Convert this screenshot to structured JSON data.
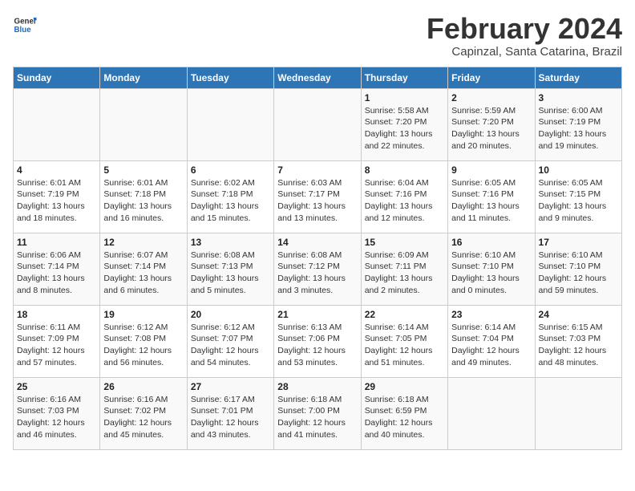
{
  "header": {
    "logo_general": "General",
    "logo_blue": "Blue",
    "month_title": "February 2024",
    "subtitle": "Capinzal, Santa Catarina, Brazil"
  },
  "days_of_week": [
    "Sunday",
    "Monday",
    "Tuesday",
    "Wednesday",
    "Thursday",
    "Friday",
    "Saturday"
  ],
  "weeks": [
    [
      {
        "day": "",
        "info": ""
      },
      {
        "day": "",
        "info": ""
      },
      {
        "day": "",
        "info": ""
      },
      {
        "day": "",
        "info": ""
      },
      {
        "day": "1",
        "info": "Sunrise: 5:58 AM\nSunset: 7:20 PM\nDaylight: 13 hours\nand 22 minutes."
      },
      {
        "day": "2",
        "info": "Sunrise: 5:59 AM\nSunset: 7:20 PM\nDaylight: 13 hours\nand 20 minutes."
      },
      {
        "day": "3",
        "info": "Sunrise: 6:00 AM\nSunset: 7:19 PM\nDaylight: 13 hours\nand 19 minutes."
      }
    ],
    [
      {
        "day": "4",
        "info": "Sunrise: 6:01 AM\nSunset: 7:19 PM\nDaylight: 13 hours\nand 18 minutes."
      },
      {
        "day": "5",
        "info": "Sunrise: 6:01 AM\nSunset: 7:18 PM\nDaylight: 13 hours\nand 16 minutes."
      },
      {
        "day": "6",
        "info": "Sunrise: 6:02 AM\nSunset: 7:18 PM\nDaylight: 13 hours\nand 15 minutes."
      },
      {
        "day": "7",
        "info": "Sunrise: 6:03 AM\nSunset: 7:17 PM\nDaylight: 13 hours\nand 13 minutes."
      },
      {
        "day": "8",
        "info": "Sunrise: 6:04 AM\nSunset: 7:16 PM\nDaylight: 13 hours\nand 12 minutes."
      },
      {
        "day": "9",
        "info": "Sunrise: 6:05 AM\nSunset: 7:16 PM\nDaylight: 13 hours\nand 11 minutes."
      },
      {
        "day": "10",
        "info": "Sunrise: 6:05 AM\nSunset: 7:15 PM\nDaylight: 13 hours\nand 9 minutes."
      }
    ],
    [
      {
        "day": "11",
        "info": "Sunrise: 6:06 AM\nSunset: 7:14 PM\nDaylight: 13 hours\nand 8 minutes."
      },
      {
        "day": "12",
        "info": "Sunrise: 6:07 AM\nSunset: 7:14 PM\nDaylight: 13 hours\nand 6 minutes."
      },
      {
        "day": "13",
        "info": "Sunrise: 6:08 AM\nSunset: 7:13 PM\nDaylight: 13 hours\nand 5 minutes."
      },
      {
        "day": "14",
        "info": "Sunrise: 6:08 AM\nSunset: 7:12 PM\nDaylight: 13 hours\nand 3 minutes."
      },
      {
        "day": "15",
        "info": "Sunrise: 6:09 AM\nSunset: 7:11 PM\nDaylight: 13 hours\nand 2 minutes."
      },
      {
        "day": "16",
        "info": "Sunrise: 6:10 AM\nSunset: 7:10 PM\nDaylight: 13 hours\nand 0 minutes."
      },
      {
        "day": "17",
        "info": "Sunrise: 6:10 AM\nSunset: 7:10 PM\nDaylight: 12 hours\nand 59 minutes."
      }
    ],
    [
      {
        "day": "18",
        "info": "Sunrise: 6:11 AM\nSunset: 7:09 PM\nDaylight: 12 hours\nand 57 minutes."
      },
      {
        "day": "19",
        "info": "Sunrise: 6:12 AM\nSunset: 7:08 PM\nDaylight: 12 hours\nand 56 minutes."
      },
      {
        "day": "20",
        "info": "Sunrise: 6:12 AM\nSunset: 7:07 PM\nDaylight: 12 hours\nand 54 minutes."
      },
      {
        "day": "21",
        "info": "Sunrise: 6:13 AM\nSunset: 7:06 PM\nDaylight: 12 hours\nand 53 minutes."
      },
      {
        "day": "22",
        "info": "Sunrise: 6:14 AM\nSunset: 7:05 PM\nDaylight: 12 hours\nand 51 minutes."
      },
      {
        "day": "23",
        "info": "Sunrise: 6:14 AM\nSunset: 7:04 PM\nDaylight: 12 hours\nand 49 minutes."
      },
      {
        "day": "24",
        "info": "Sunrise: 6:15 AM\nSunset: 7:03 PM\nDaylight: 12 hours\nand 48 minutes."
      }
    ],
    [
      {
        "day": "25",
        "info": "Sunrise: 6:16 AM\nSunset: 7:03 PM\nDaylight: 12 hours\nand 46 minutes."
      },
      {
        "day": "26",
        "info": "Sunrise: 6:16 AM\nSunset: 7:02 PM\nDaylight: 12 hours\nand 45 minutes."
      },
      {
        "day": "27",
        "info": "Sunrise: 6:17 AM\nSunset: 7:01 PM\nDaylight: 12 hours\nand 43 minutes."
      },
      {
        "day": "28",
        "info": "Sunrise: 6:18 AM\nSunset: 7:00 PM\nDaylight: 12 hours\nand 41 minutes."
      },
      {
        "day": "29",
        "info": "Sunrise: 6:18 AM\nSunset: 6:59 PM\nDaylight: 12 hours\nand 40 minutes."
      },
      {
        "day": "",
        "info": ""
      },
      {
        "day": "",
        "info": ""
      }
    ]
  ]
}
